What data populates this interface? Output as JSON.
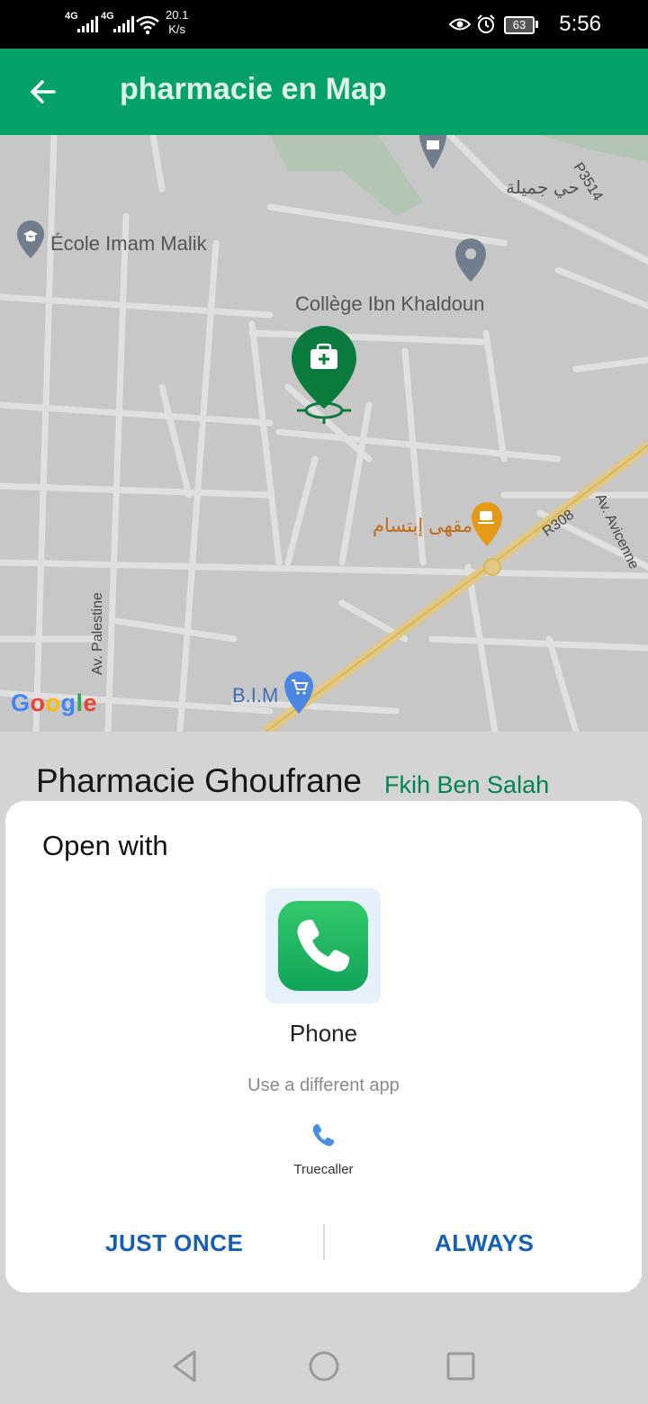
{
  "status_bar": {
    "network_1": "4G",
    "network_2": "4G",
    "speed_value": "20.1",
    "speed_unit": "K/s",
    "battery": "63",
    "time": "5:56"
  },
  "app_bar": {
    "title": "pharmacie en Map",
    "back_icon": "arrow-left-icon"
  },
  "map": {
    "labels": {
      "school": "École Imam Malik",
      "college": "Collège Ibn Khaldoun",
      "district": "حي جميلة",
      "road_p": "P3514",
      "cafe": "مقهى إبتسام",
      "road_r": "R308",
      "avicenne": "Av. Avicenne",
      "palestine": "Av. Palestine",
      "store": "B.I.M"
    },
    "google_logo": [
      "G",
      "o",
      "o",
      "g",
      "l",
      "e"
    ],
    "colors": {
      "background": "#c7c7c7",
      "road": "#e0e0e0",
      "highway": "#e2c883",
      "park": "#b3c5b3",
      "pin_green": "#0b7a3d"
    }
  },
  "place": {
    "name": "Pharmacie Ghoufrane",
    "city": "Fkih Ben Salah"
  },
  "dialog": {
    "heading": "Open with",
    "primary_app": {
      "name": "Phone",
      "icon": "phone-icon"
    },
    "different_app_label": "Use a different app",
    "alternative_app": {
      "name": "Truecaller",
      "icon": "phone-small-icon"
    },
    "actions": {
      "just_once": "JUST ONCE",
      "always": "ALWAYS"
    }
  },
  "nav_bar": {
    "back": "back-triangle-icon",
    "home": "home-circle-icon",
    "recents": "recents-square-icon"
  }
}
